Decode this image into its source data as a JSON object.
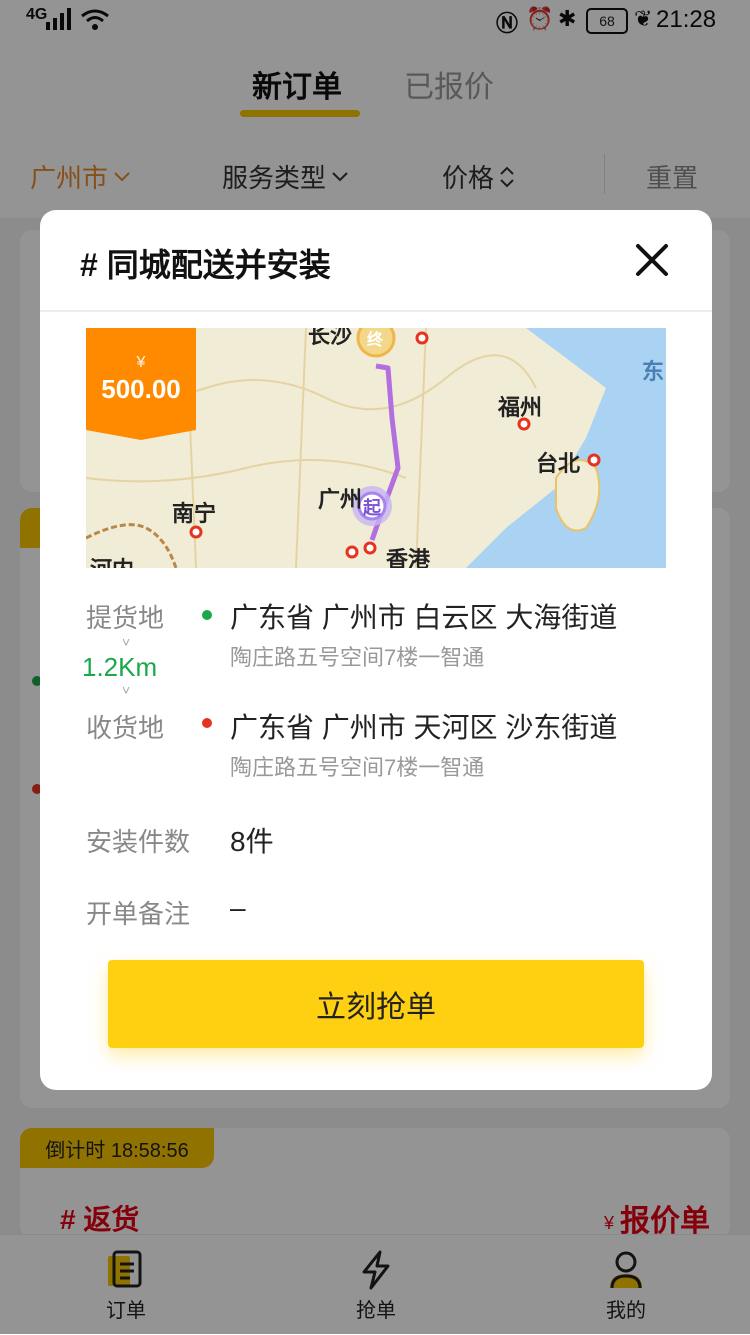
{
  "status_bar": {
    "network": "4G",
    "battery": "68",
    "time": "21:28"
  },
  "header": {
    "tabs": [
      {
        "label": "新订单"
      },
      {
        "label": "已报价"
      }
    ],
    "filters": {
      "city": "广州市",
      "service_type": "服务类型",
      "price": "价格",
      "reset": "重置"
    }
  },
  "background_card": {
    "countdown": "倒计时 18:58:56",
    "title": "# 返货",
    "quote_symbol": "¥",
    "quote_label": "报价单"
  },
  "bottom_nav": {
    "items": [
      {
        "label": "订单"
      },
      {
        "label": "抢单"
      },
      {
        "label": "我的"
      }
    ]
  },
  "modal": {
    "title": "# 同城配送并安装",
    "price": {
      "symbol": "¥",
      "amount": "500.00"
    },
    "map": {
      "labels": [
        "长沙",
        "福州",
        "台北",
        "南宁",
        "广州",
        "香港",
        "东",
        "河内"
      ],
      "start_marker": "起",
      "end_marker": "终"
    },
    "pickup": {
      "label": "提货地",
      "address": "广东省 广州市 白云区 大海街道",
      "detail": "陶庄路五号空间7楼一智通"
    },
    "distance": "1.2Km",
    "delivery": {
      "label": "收货地",
      "address": "广东省 广州市 天河区 沙东街道",
      "detail": "陶庄路五号空间7楼一智通"
    },
    "install_count": {
      "label": "安装件数",
      "value": "8件"
    },
    "remark": {
      "label": "开单备注",
      "value": "–"
    },
    "action_button": "立刻抢单"
  },
  "colors": {
    "accent": "#f6c400",
    "button": "#ffd012",
    "price_tag": "#ff8a00",
    "pickup_dot": "#19a84b",
    "delivery_dot": "#e6321e",
    "route": "#b36ee0",
    "city_text": "#e98a2e",
    "danger": "#e60012"
  }
}
